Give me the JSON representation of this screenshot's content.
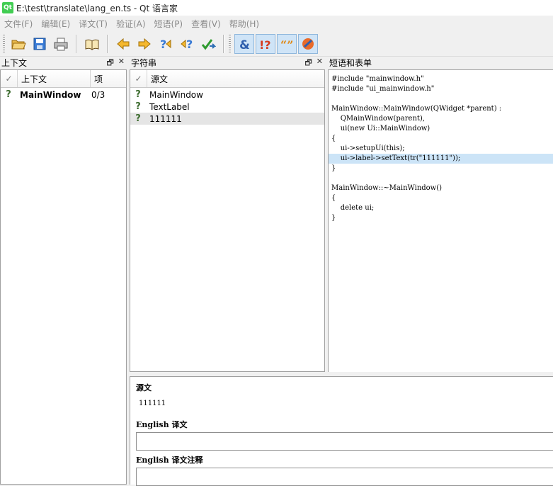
{
  "window": {
    "title": "E:\\test\\translate\\lang_en.ts - Qt 语言家",
    "app_icon": "Qt"
  },
  "menu": [
    "文件(F)",
    "编辑(E)",
    "译文(T)",
    "验证(A)",
    "短语(P)",
    "查看(V)",
    "帮助(H)"
  ],
  "toolbar": {
    "icons": [
      "open-folder-icon",
      "save-icon",
      "print-icon",
      "phrase-book-icon",
      "prev-arrow-icon",
      "next-arrow-icon",
      "prev-unfinished-icon",
      "next-unfinished-icon",
      "done-next-icon",
      "accelerator-validation-icon",
      "punctuation-validation-icon",
      "phrase-validation-icon",
      "placemarker-validation-icon"
    ]
  },
  "context_dock": {
    "title": "上下文",
    "headers": {
      "context": "上下文",
      "items": "项"
    },
    "rows": [
      {
        "name": "MainWindow",
        "count": "0/3"
      }
    ]
  },
  "strings_dock": {
    "title": "字符串",
    "headers": {
      "source": "源文"
    },
    "rows": [
      "MainWindow",
      "TextLabel",
      "111111"
    ]
  },
  "phrases_dock": {
    "title": "短语和表单",
    "code": [
      "#include \"mainwindow.h\"",
      "#include \"ui_mainwindow.h\"",
      "",
      "MainWindow::MainWindow(QWidget *parent) :",
      "    QMainWindow(parent),",
      "    ui(new Ui::MainWindow)",
      "{",
      "    ui->setupUi(this);",
      "    ui->label->setText(tr(\"111111\"));",
      "}",
      "",
      "MainWindow::~MainWindow()",
      "{",
      "    delete ui;",
      "}"
    ]
  },
  "editor": {
    "source_label": "源文",
    "source_text": "111111",
    "translation_label": "English 译文",
    "comment_label": "English 译文注释"
  },
  "dock_controls": {
    "float": "🗗",
    "close": "✕"
  }
}
